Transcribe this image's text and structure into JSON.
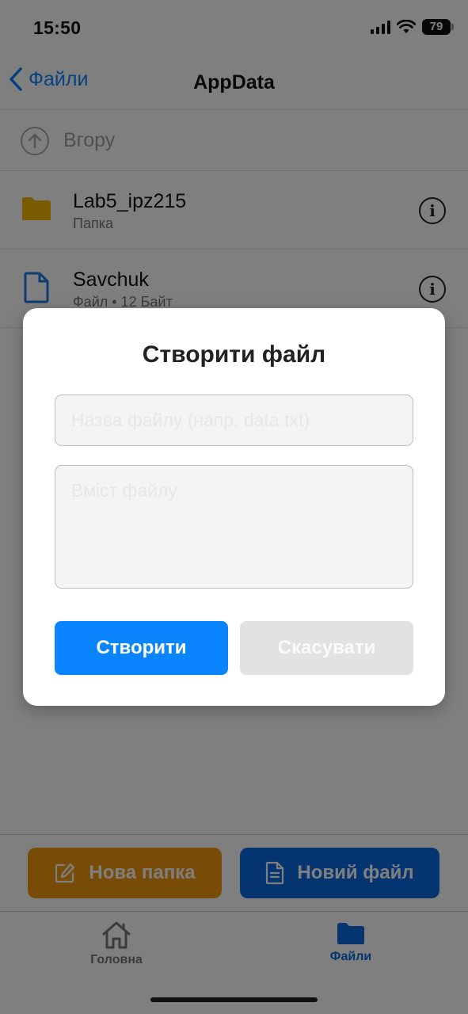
{
  "status_bar": {
    "time": "15:50",
    "battery": "79"
  },
  "nav": {
    "back_label": "Файли",
    "title": "AppData"
  },
  "up_row": {
    "label": "Вгору"
  },
  "files": [
    {
      "name": "Lab5_ipz215",
      "meta": "Папка",
      "icon": "folder-icon"
    },
    {
      "name": "Savchuk",
      "meta": "Файл • 12 Байт",
      "icon": "document-icon"
    }
  ],
  "actions": {
    "new_folder": "Нова папка",
    "new_file": "Новий файл"
  },
  "tabs": [
    {
      "label": "Головна",
      "icon": "home-icon",
      "active": false
    },
    {
      "label": "Файли",
      "icon": "folder-icon",
      "active": true
    }
  ],
  "modal": {
    "title": "Створити файл",
    "name_placeholder": "Назва файлу (напр. data.txt)",
    "content_placeholder": "Вміст файлу",
    "create_label": "Створити",
    "cancel_label": "Скасувати"
  },
  "colors": {
    "accent_blue": "#0a84ff",
    "new_file_blue": "#0a6be0",
    "new_folder_orange": "#f0960e",
    "folder_yellow": "#f5b800",
    "document_blue": "#1e7be6"
  }
}
